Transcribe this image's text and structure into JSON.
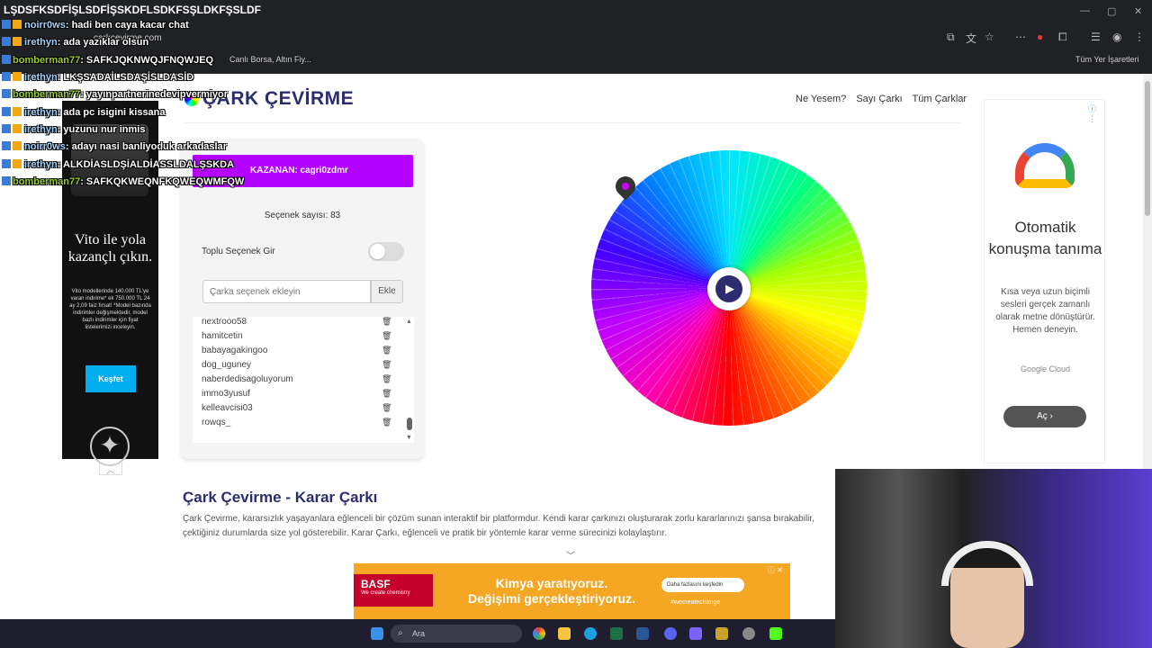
{
  "browser": {
    "url": "carkcevirme.com",
    "bookmark_item": "Canlı Borsa, Altın Fiy...",
    "bookmarks_folder": "Tüm Yer İşaretleri"
  },
  "stream": {
    "title": "LŞDSFKSDFİŞLSDFİŞSKDFLSDKFSŞLDKFŞSLDF",
    "chat": [
      {
        "user": "noirr0ws",
        "text": ": hadi ben caya kacar chat",
        "style": "u1"
      },
      {
        "user": "irethyn",
        "text": ": ada yazıklar olsun",
        "style": "u1"
      },
      {
        "user": "bomberman77",
        "text": ": SAFKJQKNWQJFNQWJEQ",
        "style": "u2"
      },
      {
        "user": "irethyn",
        "text": ": LKŞSADAİLSDAŞİSLDASİD",
        "style": "u1"
      },
      {
        "user": "bomberman77",
        "text": ": yayınpartnerinedevipvermiyor",
        "style": "u2"
      },
      {
        "user": "irethyn",
        "text": ": ada pc isigini kissana",
        "style": "u1"
      },
      {
        "user": "irethyn",
        "text": ": yuzunu nur inmis",
        "style": "u1"
      },
      {
        "user": "noirr0ws",
        "text": ": adayı nasi banliyoduk arkadaslar",
        "style": "u1"
      },
      {
        "user": "irethyn",
        "text": ": ALKDİASLDŞİALDİASSLDALŞSKDA",
        "style": "u1"
      },
      {
        "user": "bomberman77",
        "text": ": SAFKQKWEQNFKQWEQWMFQW",
        "style": "u2"
      }
    ]
  },
  "site": {
    "logo_text": "ÇARK ÇEVİRME",
    "nav": [
      "Ne Yesem?",
      "Sayı Çarkı",
      "Tüm Çarklar"
    ]
  },
  "panel": {
    "winner": "KAZANAN: cagri0zdmr",
    "option_count": "Seçenek sayısı: 83",
    "bulk_label": "Toplu Seçenek Gir",
    "bulk_enabled": false,
    "input_placeholder": "Çarka seçenek ekleyin",
    "add_button": "Ekle",
    "options": [
      "nextrooo58",
      "hamitcetin",
      "babayagakingoo",
      "dog_uguney",
      "naberdedisagoluyorum",
      "immo3yusuf",
      "kelleavcisi03",
      "rowqs_"
    ]
  },
  "section": {
    "title": "Çark Çevirme - Karar Çarkı",
    "description": "Çark Çevirme, kararsızlık yaşayanlara eğlenceli bir çözüm sunan interaktif bir platformdur. Kendi karar çarkınızı oluşturarak zorlu kararlarınızı şansa bırakabilir, çektiğiniz durumlarda size yol gösterebilir. Karar Çarkı, eğlenceli ve pratik bir yöntemle karar verme sürecinizi kolaylaştırır."
  },
  "ads": {
    "left": {
      "headline": "Vito ile yola kazançlı çıkın.",
      "text": "Vito modellerinde 140.000 TL'ye varan indirime* ek 750.000 TL 24 ay 2,09 faiz fırsat! *Model bazında indirimler değişmektedir, model bazlı indirimler için fiyat listelerimizi inceleyin.",
      "button": "Keşfet"
    },
    "right": {
      "headline": "Otomatik konuşma tanıma",
      "text": "Kısa veya uzun biçimli sesleri gerçek zamanlı olarak metne dönüştürür. Hemen deneyin.",
      "source": "Google Cloud",
      "button": "Aç ›"
    },
    "bottom": {
      "brand": "BASF",
      "brand_tag": "We create chemistry",
      "headline1": "Kimya yaratıyoruz.",
      "headline2": "Değişimi gerçekleştiriyoruz.",
      "cta": "Daha fazlasını keşfedin",
      "hashtag": "#wecreatechange"
    }
  },
  "taskbar": {
    "search_placeholder": "Ara"
  }
}
